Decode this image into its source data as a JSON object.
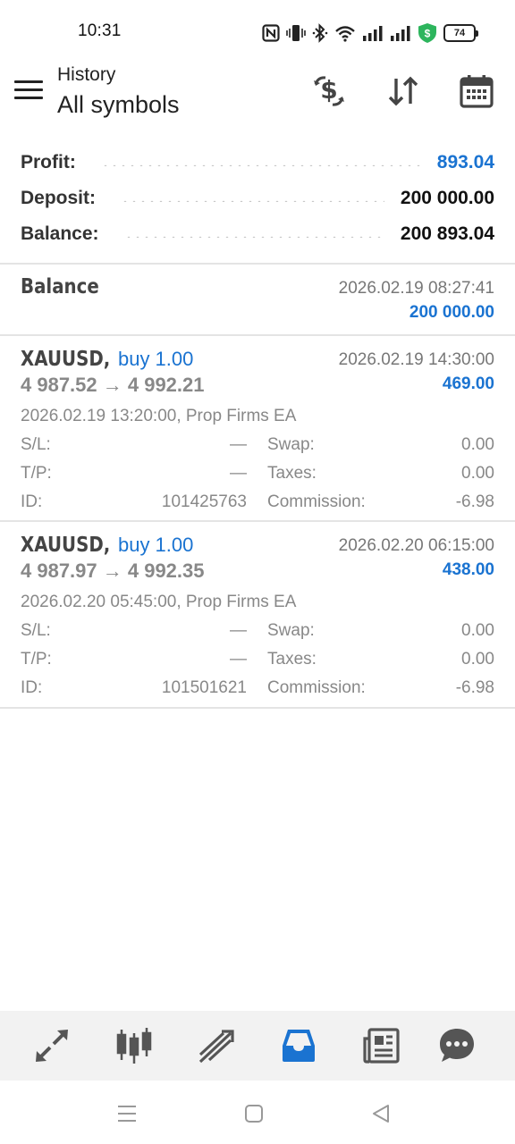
{
  "status_bar": {
    "time": "10:31",
    "battery": "74",
    "icons": [
      "nfc-icon",
      "vibrate-icon",
      "bluetooth-icon",
      "wifi-icon",
      "signal-icon",
      "signal-icon",
      "shield-icon",
      "battery-icon"
    ]
  },
  "header": {
    "subtitle": "History",
    "title": "All symbols",
    "actions": [
      "currency-exchange-icon",
      "sort-icon",
      "calendar-icon"
    ]
  },
  "summary": {
    "profit_label": "Profit:",
    "profit_value": "893.04",
    "deposit_label": "Deposit:",
    "deposit_value": "200 000.00",
    "balance_label": "Balance:",
    "balance_value": "200 893.04"
  },
  "balance_entry": {
    "label": "Balance",
    "date": "2026.02.19 08:27:41",
    "amount": "200 000.00"
  },
  "trades": [
    {
      "symbol": "XAUUSD,",
      "side": "buy 1.00",
      "prices": "4 987.52 → 4 992.21",
      "close_time": "2026.02.19 14:30:00",
      "profit": "469.00",
      "open_info": "2026.02.19 13:20:00, Prop Firms EA",
      "sl_label": "S/L:",
      "sl_value": "—",
      "tp_label": "T/P:",
      "tp_value": "—",
      "id_label": "ID:",
      "id_value": "101425763",
      "swap_label": "Swap:",
      "swap_value": "0.00",
      "taxes_label": "Taxes:",
      "taxes_value": "0.00",
      "commission_label": "Commission:",
      "commission_value": "-6.98"
    },
    {
      "symbol": "XAUUSD,",
      "side": "buy 1.00",
      "prices": "4 987.97 → 4 992.35",
      "close_time": "2026.02.20 06:15:00",
      "profit": "438.00",
      "open_info": "2026.02.20 05:45:00, Prop Firms EA",
      "sl_label": "S/L:",
      "sl_value": "—",
      "tp_label": "T/P:",
      "tp_value": "—",
      "id_label": "ID:",
      "id_value": "101501621",
      "swap_label": "Swap:",
      "swap_value": "0.00",
      "taxes_label": "Taxes:",
      "taxes_value": "0.00",
      "commission_label": "Commission:",
      "commission_value": "-6.98"
    }
  ],
  "bottom_nav": {
    "items": [
      "quotes-icon",
      "chart-icon",
      "trade-icon",
      "history-icon",
      "news-icon",
      "chat-icon"
    ],
    "active": "history-icon"
  },
  "colors": {
    "accent": "#1a73d1",
    "profit": "#1a73d1",
    "muted": "#888888",
    "nav_bg": "#f2f2f2"
  }
}
